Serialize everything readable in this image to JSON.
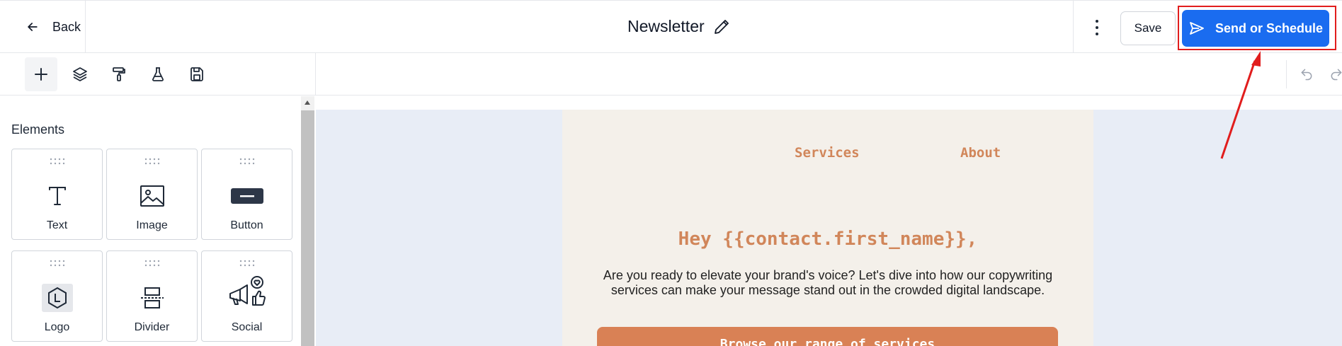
{
  "header": {
    "back_label": "Back",
    "title": "Newsletter",
    "save_label": "Save",
    "send_label": "Send or Schedule"
  },
  "toolbar": {
    "tools": [
      "plus-icon",
      "layers-icon",
      "paint-roller-icon",
      "flask-icon",
      "save-disk-icon"
    ],
    "undo_icon": "undo-icon",
    "redo_icon": "redo-icon"
  },
  "panel": {
    "title": "Elements",
    "elements": [
      {
        "label": "Text",
        "icon": "text-icon"
      },
      {
        "label": "Image",
        "icon": "image-icon"
      },
      {
        "label": "Button",
        "icon": "button-icon"
      },
      {
        "label": "Logo",
        "icon": "logo-icon"
      },
      {
        "label": "Divider",
        "icon": "divider-icon"
      },
      {
        "label": "Social",
        "icon": "social-icon"
      }
    ]
  },
  "email": {
    "nav": [
      "Services",
      "About"
    ],
    "greeting": "Hey {{contact.first_name}},",
    "body_line1": "Are you ready to elevate your brand's voice? Let's dive into how our copywriting",
    "body_line2": "services can make your message stand out in the crowded digital landscape.",
    "cta_label": "Browse our range of services"
  },
  "colors": {
    "primary_button": "#1a6cf0",
    "highlight_box": "#e11d1d",
    "email_accent": "#d1865a",
    "email_background": "#f4f0ea",
    "canvas_background": "#e8edf6"
  }
}
